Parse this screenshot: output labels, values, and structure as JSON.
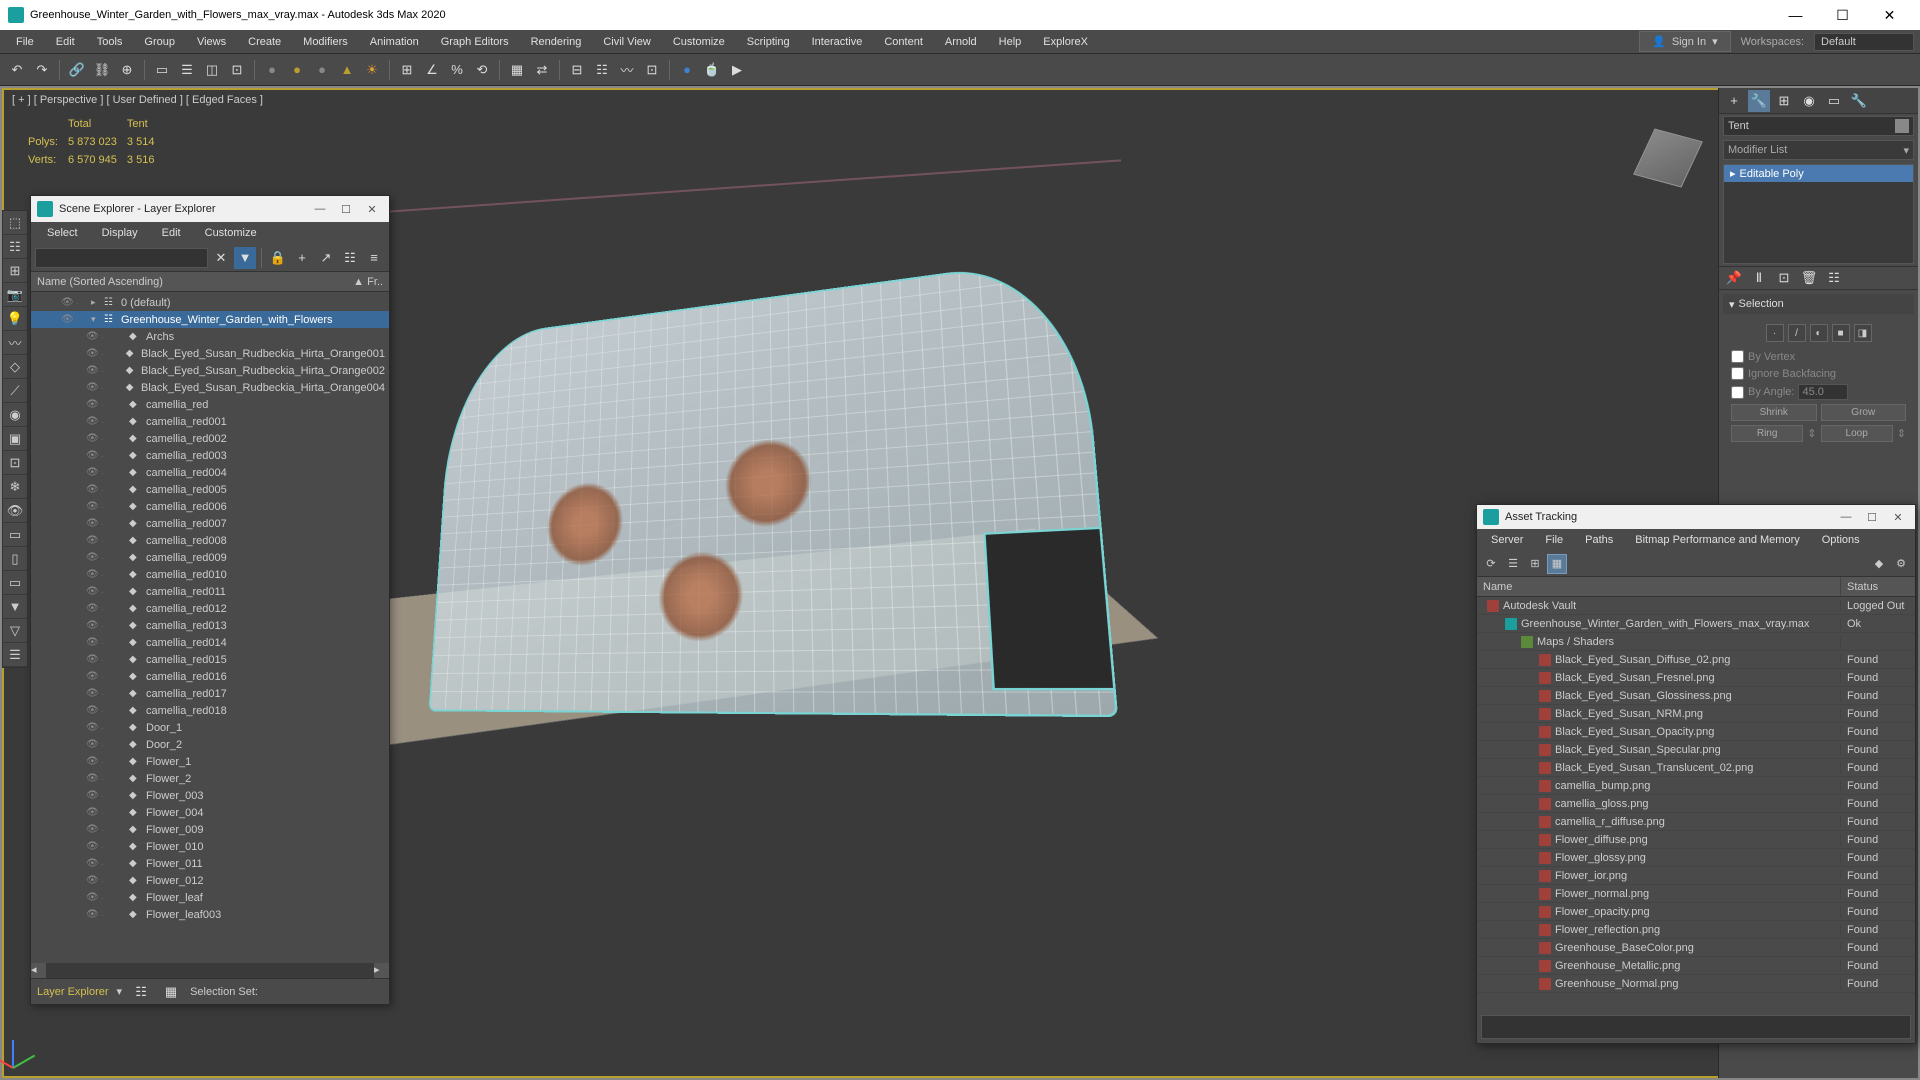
{
  "window": {
    "title": "Greenhouse_Winter_Garden_with_Flowers_max_vray.max - Autodesk 3ds Max 2020"
  },
  "menubar": [
    "File",
    "Edit",
    "Tools",
    "Group",
    "Views",
    "Create",
    "Modifiers",
    "Animation",
    "Graph Editors",
    "Rendering",
    "Civil View",
    "Customize",
    "Scripting",
    "Interactive",
    "Content",
    "Arnold",
    "Help",
    "ExploreX"
  ],
  "signin": {
    "label": "Sign In"
  },
  "workspace": {
    "label": "Workspaces:",
    "value": "Default"
  },
  "viewport": {
    "label": "[ + ] [ Perspective ] [ User Defined ] [ Edged Faces ]",
    "stats": {
      "headers": [
        "",
        "Total",
        "Tent"
      ],
      "rows": [
        [
          "Polys:",
          "5 873 023",
          "3 514"
        ],
        [
          "Verts:",
          "6 570 945",
          "3 516"
        ]
      ]
    }
  },
  "sceneExplorer": {
    "title": "Scene Explorer - Layer Explorer",
    "menus": [
      "Select",
      "Display",
      "Edit",
      "Customize"
    ],
    "header": {
      "name": "Name (Sorted Ascending)",
      "frozen": "▲ Fr.."
    },
    "footLabel": "Layer Explorer",
    "footSel": "Selection Set:",
    "tree": [
      {
        "lvl": 1,
        "name": "0 (default)",
        "toggle": "▸",
        "icon": "layer"
      },
      {
        "lvl": 1,
        "name": "Greenhouse_Winter_Garden_with_Flowers",
        "toggle": "▾",
        "icon": "layer",
        "sel": true
      },
      {
        "lvl": 2,
        "name": "Archs",
        "icon": "obj"
      },
      {
        "lvl": 2,
        "name": "Black_Eyed_Susan_Rudbeckia_Hirta_Orange001",
        "icon": "obj"
      },
      {
        "lvl": 2,
        "name": "Black_Eyed_Susan_Rudbeckia_Hirta_Orange002",
        "icon": "obj"
      },
      {
        "lvl": 2,
        "name": "Black_Eyed_Susan_Rudbeckia_Hirta_Orange004",
        "icon": "obj"
      },
      {
        "lvl": 2,
        "name": "camellia_red",
        "icon": "obj"
      },
      {
        "lvl": 2,
        "name": "camellia_red001",
        "icon": "obj"
      },
      {
        "lvl": 2,
        "name": "camellia_red002",
        "icon": "obj"
      },
      {
        "lvl": 2,
        "name": "camellia_red003",
        "icon": "obj"
      },
      {
        "lvl": 2,
        "name": "camellia_red004",
        "icon": "obj"
      },
      {
        "lvl": 2,
        "name": "camellia_red005",
        "icon": "obj"
      },
      {
        "lvl": 2,
        "name": "camellia_red006",
        "icon": "obj"
      },
      {
        "lvl": 2,
        "name": "camellia_red007",
        "icon": "obj"
      },
      {
        "lvl": 2,
        "name": "camellia_red008",
        "icon": "obj"
      },
      {
        "lvl": 2,
        "name": "camellia_red009",
        "icon": "obj"
      },
      {
        "lvl": 2,
        "name": "camellia_red010",
        "icon": "obj"
      },
      {
        "lvl": 2,
        "name": "camellia_red011",
        "icon": "obj"
      },
      {
        "lvl": 2,
        "name": "camellia_red012",
        "icon": "obj"
      },
      {
        "lvl": 2,
        "name": "camellia_red013",
        "icon": "obj"
      },
      {
        "lvl": 2,
        "name": "camellia_red014",
        "icon": "obj"
      },
      {
        "lvl": 2,
        "name": "camellia_red015",
        "icon": "obj"
      },
      {
        "lvl": 2,
        "name": "camellia_red016",
        "icon": "obj"
      },
      {
        "lvl": 2,
        "name": "camellia_red017",
        "icon": "obj"
      },
      {
        "lvl": 2,
        "name": "camellia_red018",
        "icon": "obj"
      },
      {
        "lvl": 2,
        "name": "Door_1",
        "icon": "obj"
      },
      {
        "lvl": 2,
        "name": "Door_2",
        "icon": "obj"
      },
      {
        "lvl": 2,
        "name": "Flower_1",
        "icon": "obj"
      },
      {
        "lvl": 2,
        "name": "Flower_2",
        "icon": "obj"
      },
      {
        "lvl": 2,
        "name": "Flower_003",
        "icon": "obj"
      },
      {
        "lvl": 2,
        "name": "Flower_004",
        "icon": "obj"
      },
      {
        "lvl": 2,
        "name": "Flower_009",
        "icon": "obj"
      },
      {
        "lvl": 2,
        "name": "Flower_010",
        "icon": "obj"
      },
      {
        "lvl": 2,
        "name": "Flower_011",
        "icon": "obj"
      },
      {
        "lvl": 2,
        "name": "Flower_012",
        "icon": "obj"
      },
      {
        "lvl": 2,
        "name": "Flower_leaf",
        "icon": "obj"
      },
      {
        "lvl": 2,
        "name": "Flower_leaf003",
        "icon": "obj"
      }
    ]
  },
  "commandPanel": {
    "objectName": "Tent",
    "modifierList": "Modifier List",
    "stack": "Editable Poly",
    "selection": {
      "title": "Selection",
      "byVertex": "By Vertex",
      "ignoreBF": "Ignore Backfacing",
      "byAngle": "By Angle:",
      "angleVal": "45.0",
      "shrink": "Shrink",
      "grow": "Grow",
      "ring": "Ring",
      "loop": "Loop"
    }
  },
  "assetTracking": {
    "title": "Asset Tracking",
    "menus": [
      "Server",
      "File",
      "Paths",
      "Bitmap Performance and Memory",
      "Options"
    ],
    "headerName": "Name",
    "headerStatus": "Status",
    "rows": [
      {
        "lvl": 0,
        "name": "Autodesk Vault",
        "status": "Logged Out",
        "icon": "vault"
      },
      {
        "lvl": 1,
        "name": "Greenhouse_Winter_Garden_with_Flowers_max_vray.max",
        "status": "Ok",
        "icon": "max"
      },
      {
        "lvl": 2,
        "name": "Maps / Shaders",
        "status": "",
        "icon": "folder"
      },
      {
        "lvl": 3,
        "name": "Black_Eyed_Susan_Diffuse_02.png",
        "status": "Found",
        "icon": "img"
      },
      {
        "lvl": 3,
        "name": "Black_Eyed_Susan_Fresnel.png",
        "status": "Found",
        "icon": "img"
      },
      {
        "lvl": 3,
        "name": "Black_Eyed_Susan_Glossiness.png",
        "status": "Found",
        "icon": "img"
      },
      {
        "lvl": 3,
        "name": "Black_Eyed_Susan_NRM.png",
        "status": "Found",
        "icon": "img"
      },
      {
        "lvl": 3,
        "name": "Black_Eyed_Susan_Opacity.png",
        "status": "Found",
        "icon": "img"
      },
      {
        "lvl": 3,
        "name": "Black_Eyed_Susan_Specular.png",
        "status": "Found",
        "icon": "img"
      },
      {
        "lvl": 3,
        "name": "Black_Eyed_Susan_Translucent_02.png",
        "status": "Found",
        "icon": "img"
      },
      {
        "lvl": 3,
        "name": "camellia_bump.png",
        "status": "Found",
        "icon": "img"
      },
      {
        "lvl": 3,
        "name": "camellia_gloss.png",
        "status": "Found",
        "icon": "img"
      },
      {
        "lvl": 3,
        "name": "camellia_r_diffuse.png",
        "status": "Found",
        "icon": "img"
      },
      {
        "lvl": 3,
        "name": "Flower_diffuse.png",
        "status": "Found",
        "icon": "img"
      },
      {
        "lvl": 3,
        "name": "Flower_glossy.png",
        "status": "Found",
        "icon": "img"
      },
      {
        "lvl": 3,
        "name": "Flower_ior.png",
        "status": "Found",
        "icon": "img"
      },
      {
        "lvl": 3,
        "name": "Flower_normal.png",
        "status": "Found",
        "icon": "img"
      },
      {
        "lvl": 3,
        "name": "Flower_opacity.png",
        "status": "Found",
        "icon": "img"
      },
      {
        "lvl": 3,
        "name": "Flower_reflection.png",
        "status": "Found",
        "icon": "img"
      },
      {
        "lvl": 3,
        "name": "Greenhouse_BaseColor.png",
        "status": "Found",
        "icon": "img"
      },
      {
        "lvl": 3,
        "name": "Greenhouse_Metallic.png",
        "status": "Found",
        "icon": "img"
      },
      {
        "lvl": 3,
        "name": "Greenhouse_Normal.png",
        "status": "Found",
        "icon": "img"
      }
    ]
  }
}
